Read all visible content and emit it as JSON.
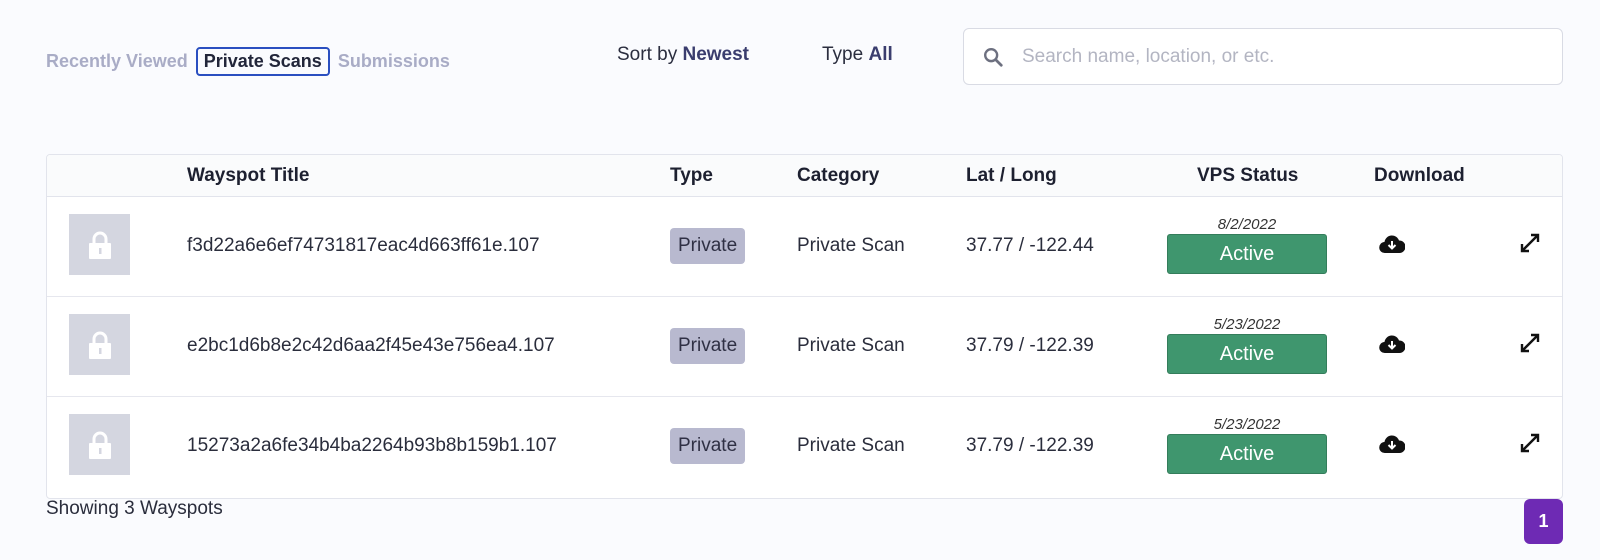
{
  "tabs": [
    {
      "label": "Recently Viewed",
      "active": false
    },
    {
      "label": "Private Scans",
      "active": true
    },
    {
      "label": "Submissions",
      "active": false
    }
  ],
  "sort": {
    "prefix": "Sort by",
    "value": "Newest"
  },
  "type_filter": {
    "prefix": "Type",
    "value": "All"
  },
  "search": {
    "placeholder": "Search name, location, or etc.",
    "value": "",
    "icon": "search-icon"
  },
  "table": {
    "headers": {
      "title": "Wayspot Title",
      "type": "Type",
      "category": "Category",
      "latlong": "Lat / Long",
      "vps": "VPS Status",
      "download": "Download"
    },
    "rows": [
      {
        "title": "f3d22a6e6ef74731817eac4d663ff61e.107",
        "type": "Private",
        "category": "Private Scan",
        "latlong": "37.77 / -122.44",
        "vps_date": "8/2/2022",
        "vps_status": "Active"
      },
      {
        "title": "e2bc1d6b8e2c42d6aa2f45e43e756ea4.107",
        "type": "Private",
        "category": "Private Scan",
        "latlong": "37.79 / -122.39",
        "vps_date": "5/23/2022",
        "vps_status": "Active"
      },
      {
        "title": "15273a2a6fe34b4ba2264b93b8b159b1.107",
        "type": "Private",
        "category": "Private Scan",
        "latlong": "37.79 / -122.39",
        "vps_date": "5/23/2022",
        "vps_status": "Active"
      }
    ]
  },
  "footer": {
    "showing": "Showing 3 Wayspots",
    "page": "1"
  },
  "colors": {
    "accent": "#2a4fc0",
    "status_active": "#3f966e",
    "badge_bg": "#b8b9cf",
    "page_button": "#6e2ab4"
  }
}
